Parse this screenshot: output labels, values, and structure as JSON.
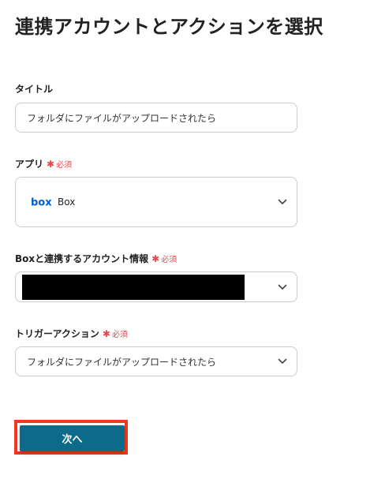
{
  "page": {
    "title": "連携アカウントとアクションを選択"
  },
  "form": {
    "title_field": {
      "label": "タイトル",
      "value": "フォルダにファイルがアップロードされたら"
    },
    "app_field": {
      "label": "アプリ",
      "required_mark": "✱",
      "required_text": "必須",
      "logo_text": "box",
      "value": "Box"
    },
    "account_field": {
      "label": "Boxと連携するアカウント情報",
      "required_mark": "✱",
      "required_text": "必須",
      "value_redacted": true
    },
    "trigger_field": {
      "label": "トリガーアクション",
      "required_mark": "✱",
      "required_text": "必須",
      "value": "フォルダにファイルがアップロードされたら"
    }
  },
  "actions": {
    "next_label": "次へ"
  },
  "colors": {
    "primary_button": "#0e6a8a",
    "highlight_border": "#ee3a1e",
    "required": "#e5484d",
    "box_brand": "#0061d5"
  },
  "icons": {
    "dropdown": "chevron-down-icon",
    "app_logo": "box-logo-icon"
  }
}
